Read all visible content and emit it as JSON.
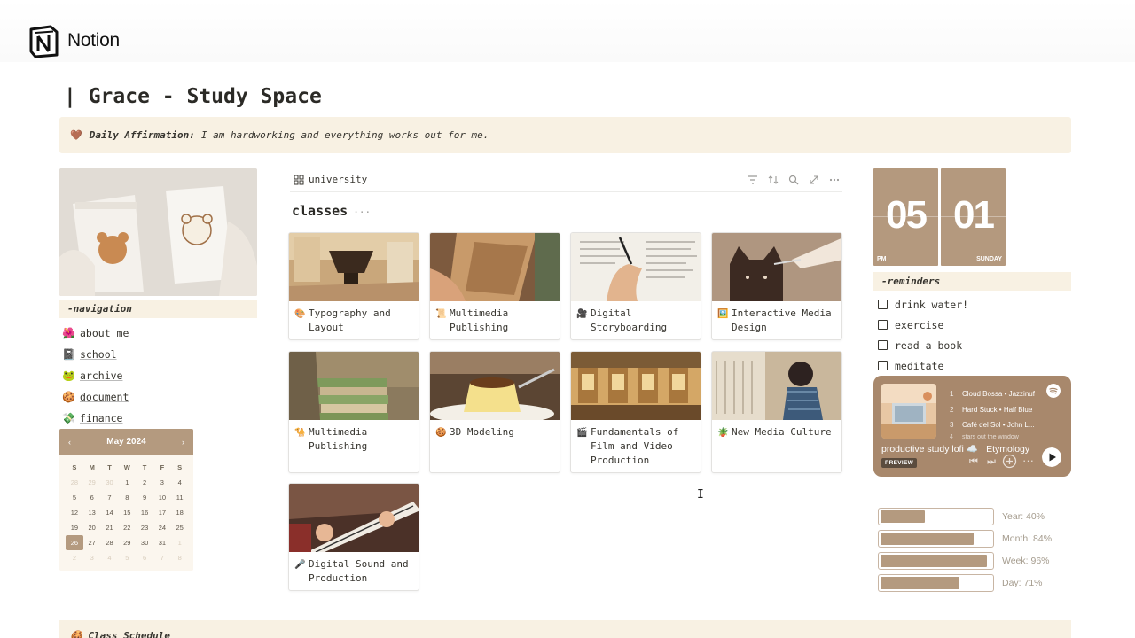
{
  "app": {
    "name": "Notion"
  },
  "page": {
    "title": "| Grace - Study Space"
  },
  "affirmation": {
    "icon": "brown-heart-icon",
    "label": "Daily Affirmation:",
    "text": "I am hardworking and everything works out for me."
  },
  "navigation": {
    "header": "-navigation",
    "items": [
      {
        "label": "about me",
        "icon": "flower-icon"
      },
      {
        "label": "school",
        "icon": "book-icon"
      },
      {
        "label": "archive",
        "icon": "frog-icon"
      },
      {
        "label": "document",
        "icon": "cookie-icon"
      },
      {
        "label": "finance",
        "icon": "money-icon"
      }
    ]
  },
  "calendar": {
    "month": "May 2024",
    "prev": "‹",
    "next": "›",
    "weekdays": [
      "S",
      "M",
      "T",
      "W",
      "T",
      "F",
      "S"
    ],
    "days": [
      [
        "28",
        "29",
        "30",
        "1",
        "2",
        "3",
        "4"
      ],
      [
        "5",
        "6",
        "7",
        "8",
        "9",
        "10",
        "11"
      ],
      [
        "12",
        "13",
        "14",
        "15",
        "16",
        "17",
        "18"
      ],
      [
        "19",
        "20",
        "21",
        "22",
        "23",
        "24",
        "25"
      ],
      [
        "26",
        "27",
        "28",
        "29",
        "30",
        "31",
        "1"
      ],
      [
        "2",
        "3",
        "4",
        "5",
        "6",
        "7",
        "8"
      ]
    ],
    "today": "26"
  },
  "database": {
    "view_name": "university",
    "title": "classes",
    "title_menu": "···",
    "tools": [
      "filter-icon",
      "sort-icon",
      "search-icon",
      "expand-icon",
      "more-icon"
    ],
    "cards": [
      {
        "title": "Typography and Layout",
        "icon": "palette-icon"
      },
      {
        "title": "Multimedia Publishing",
        "icon": "scroll-icon"
      },
      {
        "title": "Digital Storyboarding",
        "icon": "camera-icon"
      },
      {
        "title": "Interactive Media Design",
        "icon": "picture-icon"
      },
      {
        "title": "Multimedia Publishing",
        "icon": "camel-icon"
      },
      {
        "title": "3D Modeling",
        "icon": "cookie-icon"
      },
      {
        "title": "Fundamentals of Film and Video Production",
        "icon": "clapper-icon"
      },
      {
        "title": "New Media Culture",
        "icon": "plant-icon"
      },
      {
        "title": "Digital Sound and Production",
        "icon": "microphone-icon"
      }
    ]
  },
  "clock": {
    "hour": "05",
    "minute": "01",
    "period": "PM",
    "day": "SUNDAY"
  },
  "reminders": {
    "header": "-reminders",
    "items": [
      "drink water!",
      "exercise",
      "read a book",
      "meditate"
    ]
  },
  "player": {
    "tracks": [
      {
        "n": "1",
        "title": "Cloud Bossa • Jazzinuf"
      },
      {
        "n": "2",
        "title": "Hard Stuck • Half Blue"
      },
      {
        "n": "3",
        "title": "Café del Sol • John L..."
      },
      {
        "n": "4",
        "title": "stars out the window"
      }
    ],
    "playlist": "productive study lofi ☁️ · Etymology",
    "badge": "PREVIEW"
  },
  "progress": [
    {
      "label": "Year: 40%",
      "value": 40
    },
    {
      "label": "Month: 84%",
      "value": 84
    },
    {
      "label": "Week: 96%",
      "value": 96
    },
    {
      "label": "Day: 71%",
      "value": 71
    }
  ],
  "bottom": {
    "label": "Class Schedule"
  },
  "colors": {
    "accent": "#b49a7f",
    "cream": "#f8f1e3",
    "player": "#a8886c",
    "text": "#37352f"
  }
}
